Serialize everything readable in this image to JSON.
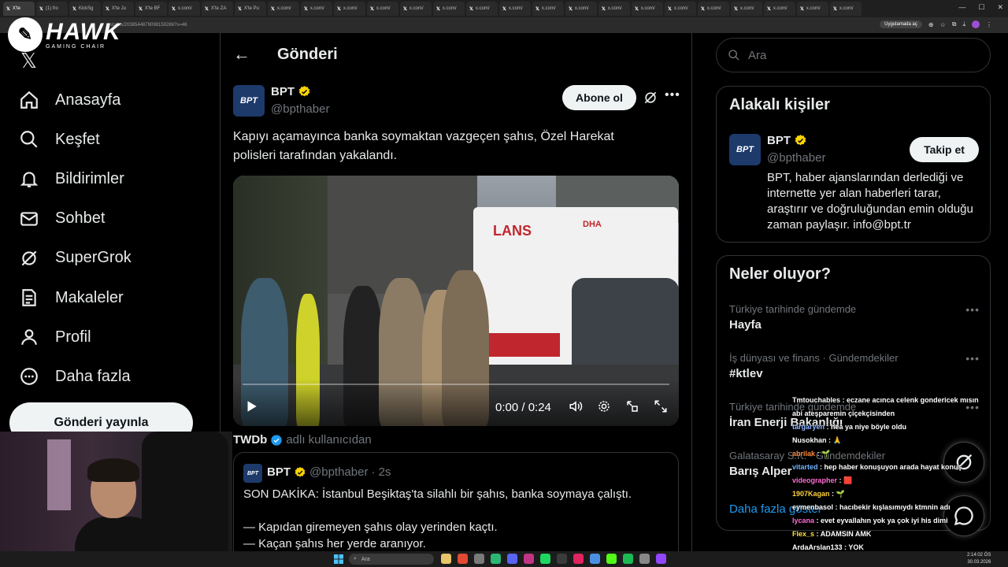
{
  "browser": {
    "tabs": [
      "X'te",
      "(1) fro",
      "KickSg",
      "X'te Ju",
      "X'te BF",
      "x.com/",
      "X'te ZA",
      "X'te Pu",
      "x.com/",
      "x.com/",
      "x.com/",
      "x.com/",
      "x.com/",
      "x.com/",
      "x.com/",
      "x.com/",
      "x.com/",
      "x.com/",
      "x.com/",
      "x.com/",
      "x.com/",
      "x.com/",
      "x.com/",
      "x.com/",
      "x.com/",
      "x.com/"
    ],
    "address": "status/2038544879098159286?s=46",
    "open_in_app": "Uygulamada aç"
  },
  "overlay": {
    "brand_name": "HAWK",
    "brand_sub": "GAMING CHAIR"
  },
  "nav": {
    "items": [
      {
        "label": "Anasayfa",
        "icon": "home-icon"
      },
      {
        "label": "Keşfet",
        "icon": "search-icon"
      },
      {
        "label": "Bildirimler",
        "icon": "bell-icon"
      },
      {
        "label": "Sohbet",
        "icon": "mail-icon"
      },
      {
        "label": "SuperGrok",
        "icon": "grok-icon"
      },
      {
        "label": "Makaleler",
        "icon": "article-icon"
      },
      {
        "label": "Profil",
        "icon": "person-icon"
      },
      {
        "label": "Daha fazla",
        "icon": "more-circle-icon"
      }
    ],
    "post_button": "Gönderi yayınla"
  },
  "main": {
    "title": "Gönderi",
    "post": {
      "avatar_text": "BPT",
      "name": "BPT",
      "handle": "@bpthaber",
      "subscribe": "Abone ol",
      "text": "Kapıyı açamayınca banka soymaktan vazgeçen şahıs, Özel Harekat polisleri tarafından yakalandı.",
      "video": {
        "time": "0:00 / 0:24",
        "ambulance_text": "LANS",
        "watermark": "DHA",
        "progress": 0
      }
    },
    "repost": {
      "name": "TWDb",
      "note": "adlı kullanıcıdan"
    },
    "quote": {
      "name": "BPT",
      "handle": "@bpthaber",
      "time": "· 2s",
      "text": "SON DAKİKA: İstanbul Beşiktaş'ta silahlı bir şahıs, banka soymaya çalıştı.\n\n— Kapıdan giremeyen şahıs olay yerinden kaçtı.\n— Kaçan şahıs her yerde aranıyor."
    }
  },
  "right": {
    "search_placeholder": "Ara",
    "related": {
      "title": "Alakalı kişiler",
      "name": "BPT",
      "handle": "@bpthaber",
      "follow": "Takip et",
      "bio": "BPT, haber ajanslarından derlediği ve internette yer alan haberleri tarar, araştırır ve doğruluğundan emin olduğu zaman paylaşır. info@bpt.tr"
    },
    "trends": {
      "title": "Neler oluyor?",
      "items": [
        {
          "category": "Türkiye tarihinde gündemde",
          "name": "Hayfa"
        },
        {
          "category": "İş dünyası ve finans · Gündemdekiler",
          "name": "#ktlev"
        },
        {
          "category": "Türkiye tarihinde gündemde",
          "name": "İran Enerji Bakanlığı"
        },
        {
          "category": "Galatasaray S.K. · Gündemdekiler",
          "name": "Barış Alper"
        }
      ],
      "show_more": "Daha fazla göster"
    }
  },
  "chat": [
    {
      "user": "Tmtouchables",
      "msg": " : eczane acınca celenk gondericek mısın",
      "color": "#ffffff"
    },
    {
      "user": "",
      "msg": "abi ateşparemin çiçekçisinden",
      "color": "#ffffff"
    },
    {
      "user": "targaryen",
      "msg": " : hea ya niye böyle oldu",
      "color": "#8fb4ff"
    },
    {
      "user": "Nusokhan",
      "msg": " : 🙏",
      "color": "#ffffff"
    },
    {
      "user": "abrilak",
      "msg": " : 🌱",
      "color": "#ff8a3d"
    },
    {
      "user": "vitarted",
      "msg": " : hep haber konuşuyon arada hayat konuş",
      "color": "#6fb3ff"
    },
    {
      "user": "videographer",
      "msg": " : 🟥",
      "color": "#ff6bd5"
    },
    {
      "user": "1907Kagan",
      "msg": " : 🌱",
      "color": "#ffd23d"
    },
    {
      "user": "eymenbasol",
      "msg": " : hacıbekir kışlasımıydı ktmnin adı",
      "color": "#ffffff"
    },
    {
      "user": "lycana",
      "msg": " : evet eyvallahın yok ya çok iyi his dimi",
      "color": "#ff6bd5"
    },
    {
      "user": "Flex_s",
      "msg": " : ADAMSIN AMK",
      "color": "#ffe23d"
    },
    {
      "user": "ArdaArslan133",
      "msg": " : YOK",
      "color": "#ffffff"
    }
  ],
  "taskbar": {
    "search": "Ara",
    "time": "2:14:02 ÖS",
    "date": "30.03.2026"
  },
  "colors": {
    "accent": "#1d9bf0",
    "verified": "#ffd400",
    "border": "#2f3336"
  }
}
